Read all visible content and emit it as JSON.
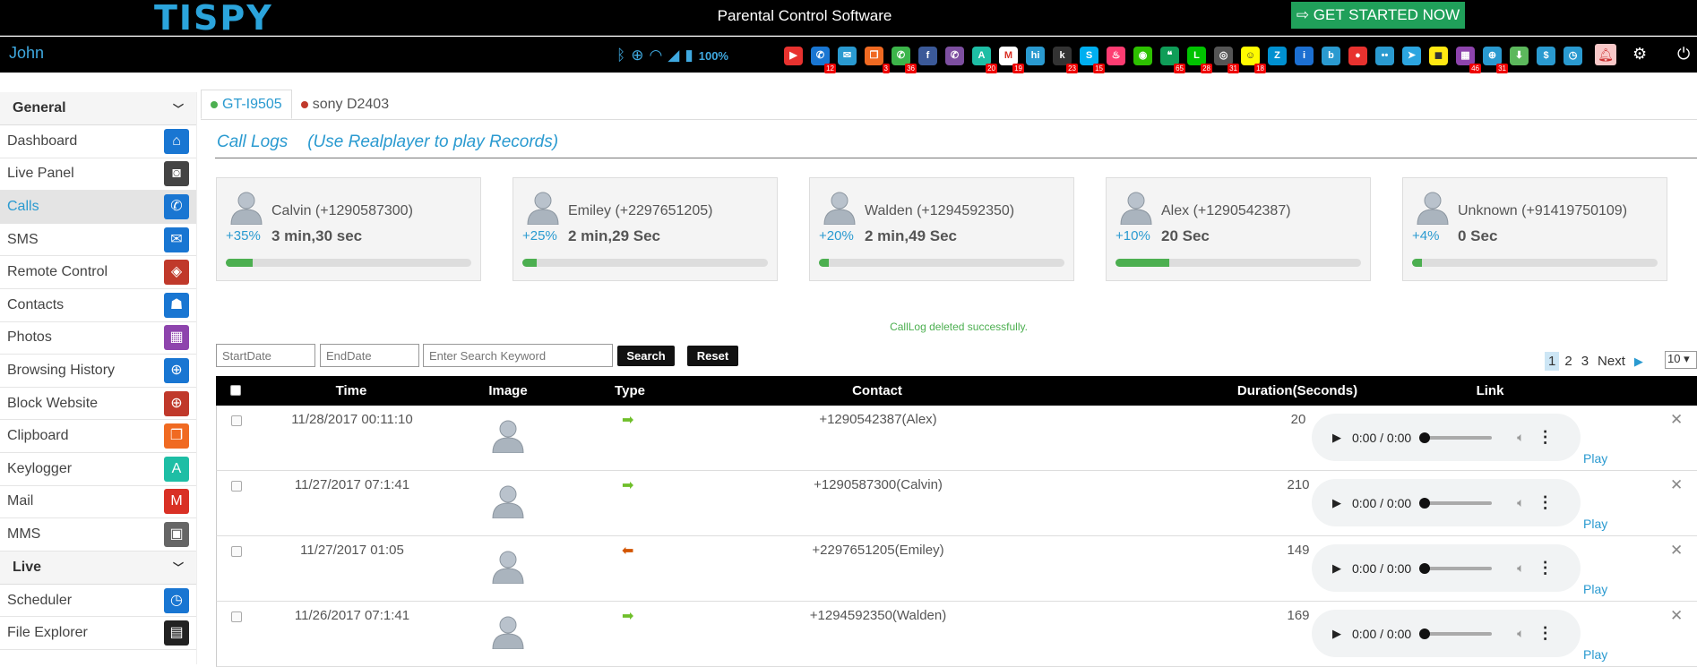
{
  "header": {
    "logo": "TISPY",
    "app_title": "Parental Control Software",
    "cta_label": "GET STARTED NOW",
    "user": "John",
    "battery": "100%"
  },
  "app_icons": [
    {
      "name": "video-call-icon",
      "color": "#e8322f",
      "glyph": "▶",
      "badge": ""
    },
    {
      "name": "phone-icon",
      "color": "#1976d2",
      "glyph": "✆",
      "badge": "12"
    },
    {
      "name": "email-icon",
      "color": "#2a9ad0",
      "glyph": "✉",
      "badge": ""
    },
    {
      "name": "clipboard-icon",
      "color": "#f06a22",
      "glyph": "❐",
      "badge": "3"
    },
    {
      "name": "whatsapp-icon",
      "color": "#3cb54a",
      "glyph": "✆",
      "badge": "36"
    },
    {
      "name": "facebook-icon",
      "color": "#3b5998",
      "glyph": "f",
      "badge": ""
    },
    {
      "name": "viber-icon",
      "color": "#7d4fa0",
      "glyph": "✆",
      "badge": ""
    },
    {
      "name": "keylogger-icon",
      "color": "#1ebea5",
      "glyph": "A",
      "badge": "20"
    },
    {
      "name": "gmail-icon",
      "color": "#ffffff",
      "glyph": "M",
      "badge": "19"
    },
    {
      "name": "hike-icon",
      "color": "#2a9ad0",
      "glyph": "hi",
      "badge": ""
    },
    {
      "name": "kik-icon",
      "color": "#333333",
      "glyph": "k",
      "badge": "23"
    },
    {
      "name": "skype-icon",
      "color": "#00aff0",
      "glyph": "S",
      "badge": "15"
    },
    {
      "name": "tinder-icon",
      "color": "#fe3c72",
      "glyph": "♨",
      "badge": ""
    },
    {
      "name": "wechat-icon",
      "color": "#2dc100",
      "glyph": "◉",
      "badge": ""
    },
    {
      "name": "hangouts-icon",
      "color": "#0f9d58",
      "glyph": "❝",
      "badge": "65"
    },
    {
      "name": "line-icon",
      "color": "#00c300",
      "glyph": "L",
      "badge": "28"
    },
    {
      "name": "instagram-icon",
      "color": "#555555",
      "glyph": "◎",
      "badge": "31"
    },
    {
      "name": "snapchat-icon",
      "color": "#fffc00",
      "glyph": "☺",
      "badge": "18"
    },
    {
      "name": "zalo-icon",
      "color": "#0090d0",
      "glyph": "Z",
      "badge": ""
    },
    {
      "name": "imo-icon",
      "color": "#1c6fd1",
      "glyph": "i",
      "badge": ""
    },
    {
      "name": "bip-icon",
      "color": "#2a9ad0",
      "glyph": "b",
      "badge": ""
    },
    {
      "name": "camera-video-icon",
      "color": "#e8322f",
      "glyph": "●",
      "badge": ""
    },
    {
      "name": "flickr-icon",
      "color": "#2a9ad0",
      "glyph": "••",
      "badge": ""
    },
    {
      "name": "telegram-icon",
      "color": "#2ca5e0",
      "glyph": "➤",
      "badge": ""
    },
    {
      "name": "kakaotalk-icon",
      "color": "#ffe812",
      "glyph": "◼",
      "badge": ""
    },
    {
      "name": "photos-icon",
      "color": "#8e44ad",
      "glyph": "▦",
      "badge": "46"
    },
    {
      "name": "browser-icon",
      "color": "#2a9ad0",
      "glyph": "⊕",
      "badge": "31"
    },
    {
      "name": "download-icon",
      "color": "#5cb85c",
      "glyph": "⬇",
      "badge": ""
    },
    {
      "name": "dollar-icon",
      "color": "#2a9ad0",
      "glyph": "$",
      "badge": ""
    },
    {
      "name": "clock-icon",
      "color": "#2a9ad0",
      "glyph": "◷",
      "badge": ""
    }
  ],
  "sidebar": {
    "groups": [
      {
        "title": "General",
        "items": [
          {
            "label": "Dashboard",
            "icon": "home-icon",
            "glyph": "⌂",
            "color": "#1976d2",
            "active": false
          },
          {
            "label": "Live Panel",
            "icon": "camera-icon",
            "glyph": "◙",
            "color": "#444444",
            "active": false
          },
          {
            "label": "Calls",
            "icon": "phone-icon",
            "glyph": "✆",
            "color": "#1976d2",
            "active": true
          },
          {
            "label": "SMS",
            "icon": "envelope-icon",
            "glyph": "✉",
            "color": "#1976d2",
            "active": false
          },
          {
            "label": "Remote Control",
            "icon": "map-icon",
            "glyph": "◈",
            "color": "#c0392b",
            "active": false
          },
          {
            "label": "Contacts",
            "icon": "contact-icon",
            "glyph": "☗",
            "color": "#1976d2",
            "active": false
          },
          {
            "label": "Photos",
            "icon": "photo-icon",
            "glyph": "▦",
            "color": "#8e44ad",
            "active": false
          },
          {
            "label": "Browsing History",
            "icon": "globe-icon",
            "glyph": "⊕",
            "color": "#1976d2",
            "active": false
          },
          {
            "label": "Block Website",
            "icon": "globe-block-icon",
            "glyph": "⊕",
            "color": "#c0392b",
            "active": false
          },
          {
            "label": "Clipboard",
            "icon": "clipboard-icon",
            "glyph": "❐",
            "color": "#f06a22",
            "active": false
          },
          {
            "label": "Keylogger",
            "icon": "keyboard-icon",
            "glyph": "A",
            "color": "#1ebea5",
            "active": false
          },
          {
            "label": "Mail",
            "icon": "gmail-icon",
            "glyph": "M",
            "color": "#d93025",
            "active": false
          },
          {
            "label": "MMS",
            "icon": "mms-icon",
            "glyph": "▣",
            "color": "#666666",
            "active": false
          }
        ]
      },
      {
        "title": "Live",
        "items": [
          {
            "label": "Scheduler",
            "icon": "clock-icon",
            "glyph": "◷",
            "color": "#1976d2",
            "active": false
          },
          {
            "label": "File Explorer",
            "icon": "file-explorer-icon",
            "glyph": "▤",
            "color": "#222222",
            "active": false
          }
        ]
      }
    ]
  },
  "devices": [
    {
      "label": "GT-I9505",
      "status_color": "#4caf50",
      "active": true
    },
    {
      "label": "sony D2403",
      "status_color": "#c0392b",
      "active": false
    }
  ],
  "section": {
    "title": "Call Logs",
    "hint": "(Use Realplayer to play Records)"
  },
  "top_contacts": [
    {
      "name": "Calvin (+1290587300)",
      "percent": "+35%",
      "duration": "3 min,30 sec",
      "fill": 0.11
    },
    {
      "name": "Emiley (+2297651205)",
      "percent": "+25%",
      "duration": "2 min,29 Sec",
      "fill": 0.06
    },
    {
      "name": "Walden (+1294592350)",
      "percent": "+20%",
      "duration": "2 min,49 Sec",
      "fill": 0.04
    },
    {
      "name": "Alex (+1290542387)",
      "percent": "+10%",
      "duration": "20 Sec",
      "fill": 0.22
    },
    {
      "name": "Unknown (+91419750109)",
      "percent": "+4%",
      "duration": "0 Sec",
      "fill": 0.04
    }
  ],
  "flash_message": "CallLog deleted successfully.",
  "filters": {
    "start_placeholder": "StartDate",
    "end_placeholder": "EndDate",
    "keyword_placeholder": "Enter Search Keyword",
    "search_label": "Search",
    "reset_label": "Reset"
  },
  "pager": {
    "pages": [
      "1",
      "2",
      "3"
    ],
    "current": "1",
    "next_label": "Next",
    "page_size": "10"
  },
  "table": {
    "columns": [
      "Time",
      "Image",
      "Type",
      "Contact",
      "Duration(Seconds)",
      "Link"
    ],
    "rows": [
      {
        "time": "11/28/2017 00:11:10",
        "type": "outgoing",
        "contact": "+1290542387(Alex)",
        "duration": "20",
        "audio": "0:00 / 0:00",
        "link": "Play"
      },
      {
        "time": "11/27/2017 07:1:41",
        "type": "outgoing",
        "contact": "+1290587300(Calvin)",
        "duration": "210",
        "audio": "0:00 / 0:00",
        "link": "Play"
      },
      {
        "time": "11/27/2017 01:05",
        "type": "incoming",
        "contact": "+2297651205(Emiley)",
        "duration": "149",
        "audio": "0:00 / 0:00",
        "link": "Play"
      },
      {
        "time": "11/26/2017 07:1:41",
        "type": "outgoing",
        "contact": "+1294592350(Walden)",
        "duration": "169",
        "audio": "0:00 / 0:00",
        "link": "Play"
      }
    ]
  }
}
